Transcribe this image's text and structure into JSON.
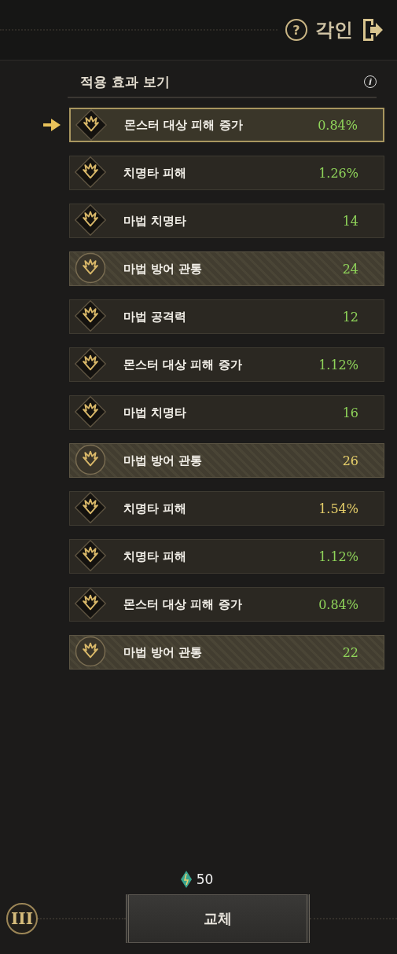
{
  "header": {
    "help_icon": "?",
    "title": "각인"
  },
  "list_header": {
    "title": "적용 효과 보기",
    "info_icon": "i"
  },
  "effects": [
    {
      "kind": "diamond",
      "name": "몬스터 대상 피해 증가",
      "value": "0.84%",
      "color": "#8fd45a",
      "selected": true
    },
    {
      "kind": "diamond",
      "name": "치명타 피해",
      "value": "1.26%",
      "color": "#8fd45a",
      "selected": false
    },
    {
      "kind": "diamond",
      "name": "마법 치명타",
      "value": "14",
      "color": "#8fd45a",
      "selected": false
    },
    {
      "kind": "circle",
      "name": "마법 방어 관통",
      "value": "24",
      "color": "#8fd45a",
      "selected": false
    },
    {
      "kind": "diamond",
      "name": "마법 공격력",
      "value": "12",
      "color": "#8fd45a",
      "selected": false
    },
    {
      "kind": "diamond",
      "name": "몬스터 대상 피해 증가",
      "value": "1.12%",
      "color": "#8fd45a",
      "selected": false
    },
    {
      "kind": "diamond",
      "name": "마법 치명타",
      "value": "16",
      "color": "#8fd45a",
      "selected": false
    },
    {
      "kind": "circle",
      "name": "마법 방어 관통",
      "value": "26",
      "color": "#e6cf6a",
      "selected": false
    },
    {
      "kind": "diamond",
      "name": "치명타 피해",
      "value": "1.54%",
      "color": "#e6cf6a",
      "selected": false
    },
    {
      "kind": "diamond",
      "name": "치명타 피해",
      "value": "1.12%",
      "color": "#8fd45a",
      "selected": false
    },
    {
      "kind": "diamond",
      "name": "몬스터 대상 피해 증가",
      "value": "0.84%",
      "color": "#8fd45a",
      "selected": false
    },
    {
      "kind": "circle",
      "name": "마법 방어 관통",
      "value": "22",
      "color": "#8fd45a",
      "selected": false
    }
  ],
  "footer": {
    "tier_badge": "III",
    "cost": "50",
    "button": "교체"
  }
}
